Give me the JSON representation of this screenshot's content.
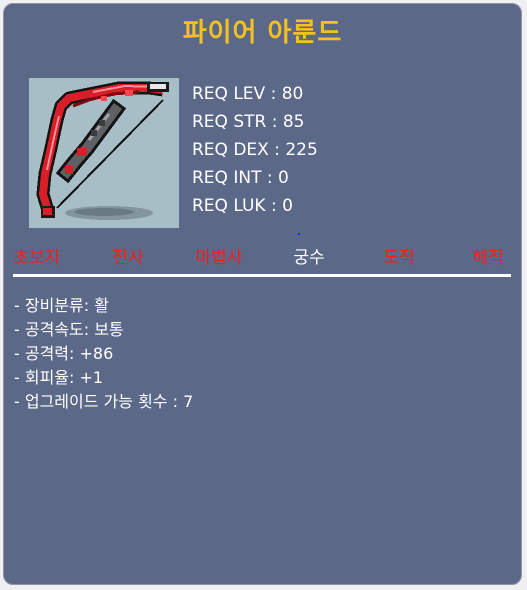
{
  "item": {
    "name": "파이어 아룬드",
    "icon": "bow-icon",
    "name_color": "#f4c023"
  },
  "requirements": [
    "REQ LEV : 80",
    "REQ STR : 85",
    "REQ DEX : 225",
    "REQ INT : 0",
    "REQ LUK : 0"
  ],
  "jobs": [
    {
      "label": "초보자",
      "available": false,
      "color": "#ff1a1a"
    },
    {
      "label": "전사",
      "available": false,
      "color": "#ff1a1a"
    },
    {
      "label": "마법사",
      "available": false,
      "color": "#ff1a1a"
    },
    {
      "label": "궁수",
      "available": true,
      "color": "#ffffff"
    },
    {
      "label": "도적",
      "available": false,
      "color": "#ff1a1a"
    },
    {
      "label": "해적",
      "available": false,
      "color": "#ff1a1a"
    }
  ],
  "properties": [
    "- 장비분류: 활",
    "- 공격속도: 보통",
    "- 공격력: +86",
    "- 회피율: +1",
    "- 업그레이드 가능 횟수 : 7"
  ],
  "colors": {
    "panel": "#5b6888",
    "text": "#ffffff",
    "unavailable": "#ff1a1a"
  }
}
